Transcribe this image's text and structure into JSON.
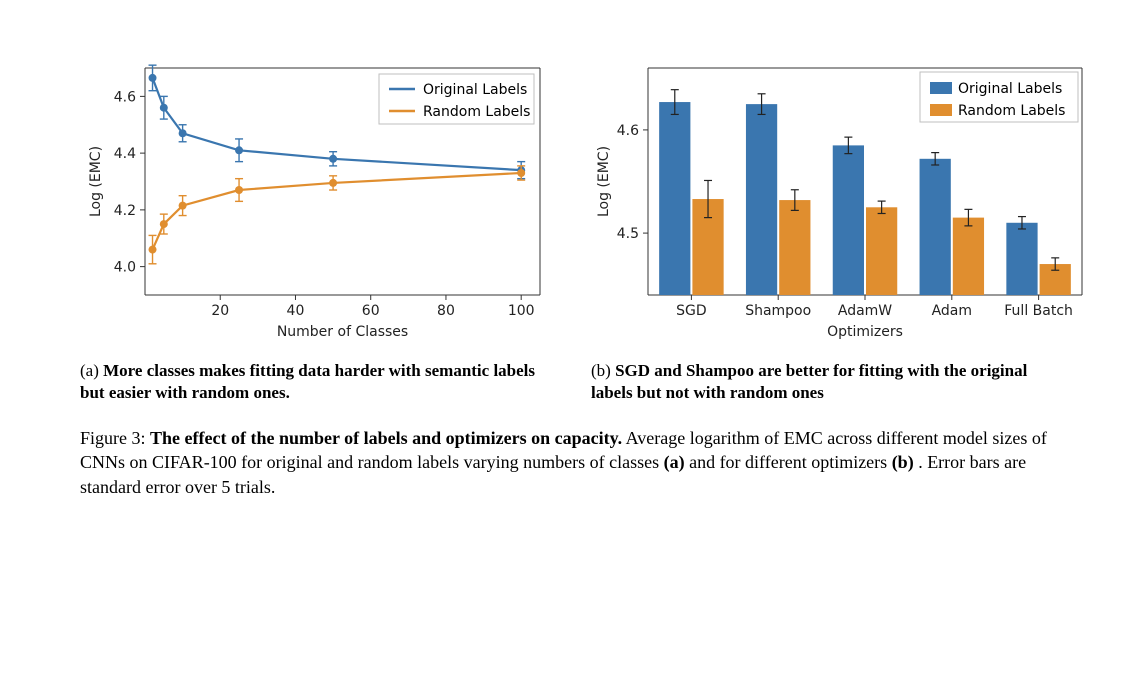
{
  "colors": {
    "blue": "#3a76af",
    "orange": "#e08e2f",
    "axis": "#333333",
    "spine": "#666666",
    "legend_border": "#bfbfbf"
  },
  "chart_data": [
    {
      "id": "a",
      "type": "line",
      "xlabel": "Number of Classes",
      "ylabel": "Log (EMC)",
      "xlim": [
        0,
        105
      ],
      "ylim": [
        3.9,
        4.7
      ],
      "xticks": [
        20,
        40,
        60,
        80,
        100
      ],
      "yticks": [
        4.0,
        4.2,
        4.4,
        4.6
      ],
      "legend": [
        "Original Labels",
        "Random Labels"
      ],
      "legend_pos": "upper right",
      "x": [
        2,
        5,
        10,
        25,
        50,
        100
      ],
      "series": [
        {
          "name": "Original Labels",
          "values": [
            4.665,
            4.56,
            4.47,
            4.41,
            4.38,
            4.34
          ],
          "err": [
            0.045,
            0.04,
            0.03,
            0.04,
            0.025,
            0.03
          ]
        },
        {
          "name": "Random Labels",
          "values": [
            4.06,
            4.15,
            4.215,
            4.27,
            4.295,
            4.33
          ],
          "err": [
            0.05,
            0.035,
            0.035,
            0.04,
            0.025,
            0.025
          ]
        }
      ]
    },
    {
      "id": "b",
      "type": "bar",
      "xlabel": "Optimizers",
      "ylabel": "Log (EMC)",
      "ylim": [
        4.44,
        4.66
      ],
      "yticks": [
        4.5,
        4.6
      ],
      "categories": [
        "SGD",
        "Shampoo",
        "AdamW",
        "Adam",
        "Full Batch"
      ],
      "legend": [
        "Original Labels",
        "Random Labels"
      ],
      "legend_pos": "upper right",
      "series": [
        {
          "name": "Original Labels",
          "values": [
            4.627,
            4.625,
            4.585,
            4.572,
            4.51
          ],
          "err": [
            0.012,
            0.01,
            0.008,
            0.006,
            0.006
          ]
        },
        {
          "name": "Random Labels",
          "values": [
            4.533,
            4.532,
            4.525,
            4.515,
            4.47
          ],
          "err": [
            0.018,
            0.01,
            0.006,
            0.008,
            0.006
          ]
        }
      ]
    }
  ],
  "subcaptions": {
    "a": {
      "tag": "(a)",
      "bold": "More classes makes fitting data harder with semantic labels but easier with random ones."
    },
    "b": {
      "tag": "(b)",
      "bold": "SGD and Shampoo are better for fitting with the original labels but not with random ones"
    }
  },
  "caption": {
    "fig_label": "Figure 3:",
    "bold_title": "The effect of the number of labels and optimizers on capacity.",
    "rest_1": " Average logarithm of EMC across different model sizes of CNNs on CIFAR-100 for original and random labels varying numbers of classes ",
    "bold_a": "(a)",
    "rest_2": " and for different optimizers ",
    "bold_b": "(b)",
    "rest_3": ". Error bars are standard error over 5 trials."
  }
}
